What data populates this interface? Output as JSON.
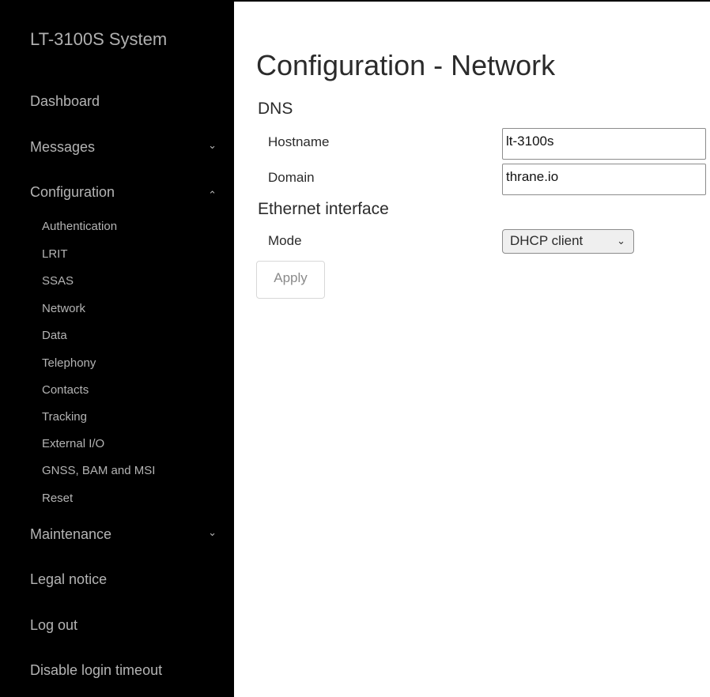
{
  "sidebar": {
    "brand": "LT-3100S System",
    "items": {
      "dashboard": {
        "label": "Dashboard"
      },
      "messages": {
        "label": "Messages",
        "chevron": "chevron-down-icon",
        "glyph": "⌄"
      },
      "configuration": {
        "label": "Configuration",
        "chevron": "chevron-up-icon",
        "glyph": "⌃"
      },
      "maintenance": {
        "label": "Maintenance",
        "chevron": "chevron-down-icon",
        "glyph": "⌄"
      },
      "legal": {
        "label": "Legal notice"
      },
      "logout": {
        "label": "Log out"
      },
      "disable_timeout": {
        "label": "Disable login timeout"
      }
    },
    "config_subitems": [
      "Authentication",
      "LRIT",
      "SSAS",
      "Network",
      "Data",
      "Telephony",
      "Contacts",
      "Tracking",
      "External I/O",
      "GNSS, BAM and MSI",
      "Reset"
    ]
  },
  "main": {
    "title": "Configuration - Network",
    "dns": {
      "heading": "DNS",
      "hostname_label": "Hostname",
      "hostname_value": "lt-3100s",
      "domain_label": "Domain",
      "domain_value": "thrane.io"
    },
    "ethernet": {
      "heading": "Ethernet interface",
      "mode_label": "Mode",
      "mode_value": "DHCP client",
      "mode_glyph": "⌄"
    },
    "apply_label": "Apply"
  },
  "colors": {
    "sidebar_bg": "#000000",
    "sidebar_text": "#b4b4b4",
    "main_text": "#2b2b2b"
  }
}
